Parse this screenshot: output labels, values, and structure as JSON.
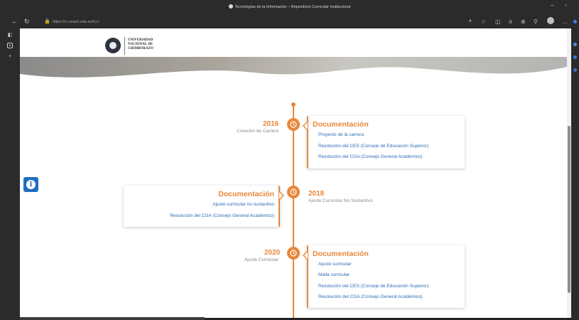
{
  "browser": {
    "window_title": "Tecnologías de la Información – Repositorio Curricular Institucional",
    "url": "https://rc.unach.edu.ec/ti.c/"
  },
  "site": {
    "logo_line1": "UNIVERSIDAD",
    "logo_line2": "NACIONAL DE",
    "logo_line3": "CHIMBORAZO"
  },
  "timeline": [
    {
      "year": "2016",
      "subtitle": "Creación de Carrera",
      "card_title": "Documentación",
      "links": [
        "Proyecto de la carrera",
        "Resolución del CES (Consejo de Educación Superior)",
        "Resolución del CGA (Consejo General Académico)"
      ]
    },
    {
      "year": "2018",
      "subtitle": "Ajuste Curricular No Sustantivo",
      "card_title": "Documentación",
      "links": [
        "Ajuste curricular no sustantivo",
        "Resolución del CGA (Consejo General Académico)"
      ]
    },
    {
      "year": "2020",
      "subtitle": "Ajuste Curricular",
      "card_title": "Documentación",
      "links": [
        "Ajuste curricular",
        "Malla curricular",
        "Resolución del CES (Consejo de Educación Superior)",
        "Resolución del CGA (Consejo General Académico)"
      ]
    }
  ],
  "colors": {
    "accent": "#e8873a",
    "link": "#2f6bb6",
    "info_button": "#1f6fbd"
  },
  "icons": {
    "timeline_node": "clock-icon",
    "info_button": "info-icon"
  }
}
